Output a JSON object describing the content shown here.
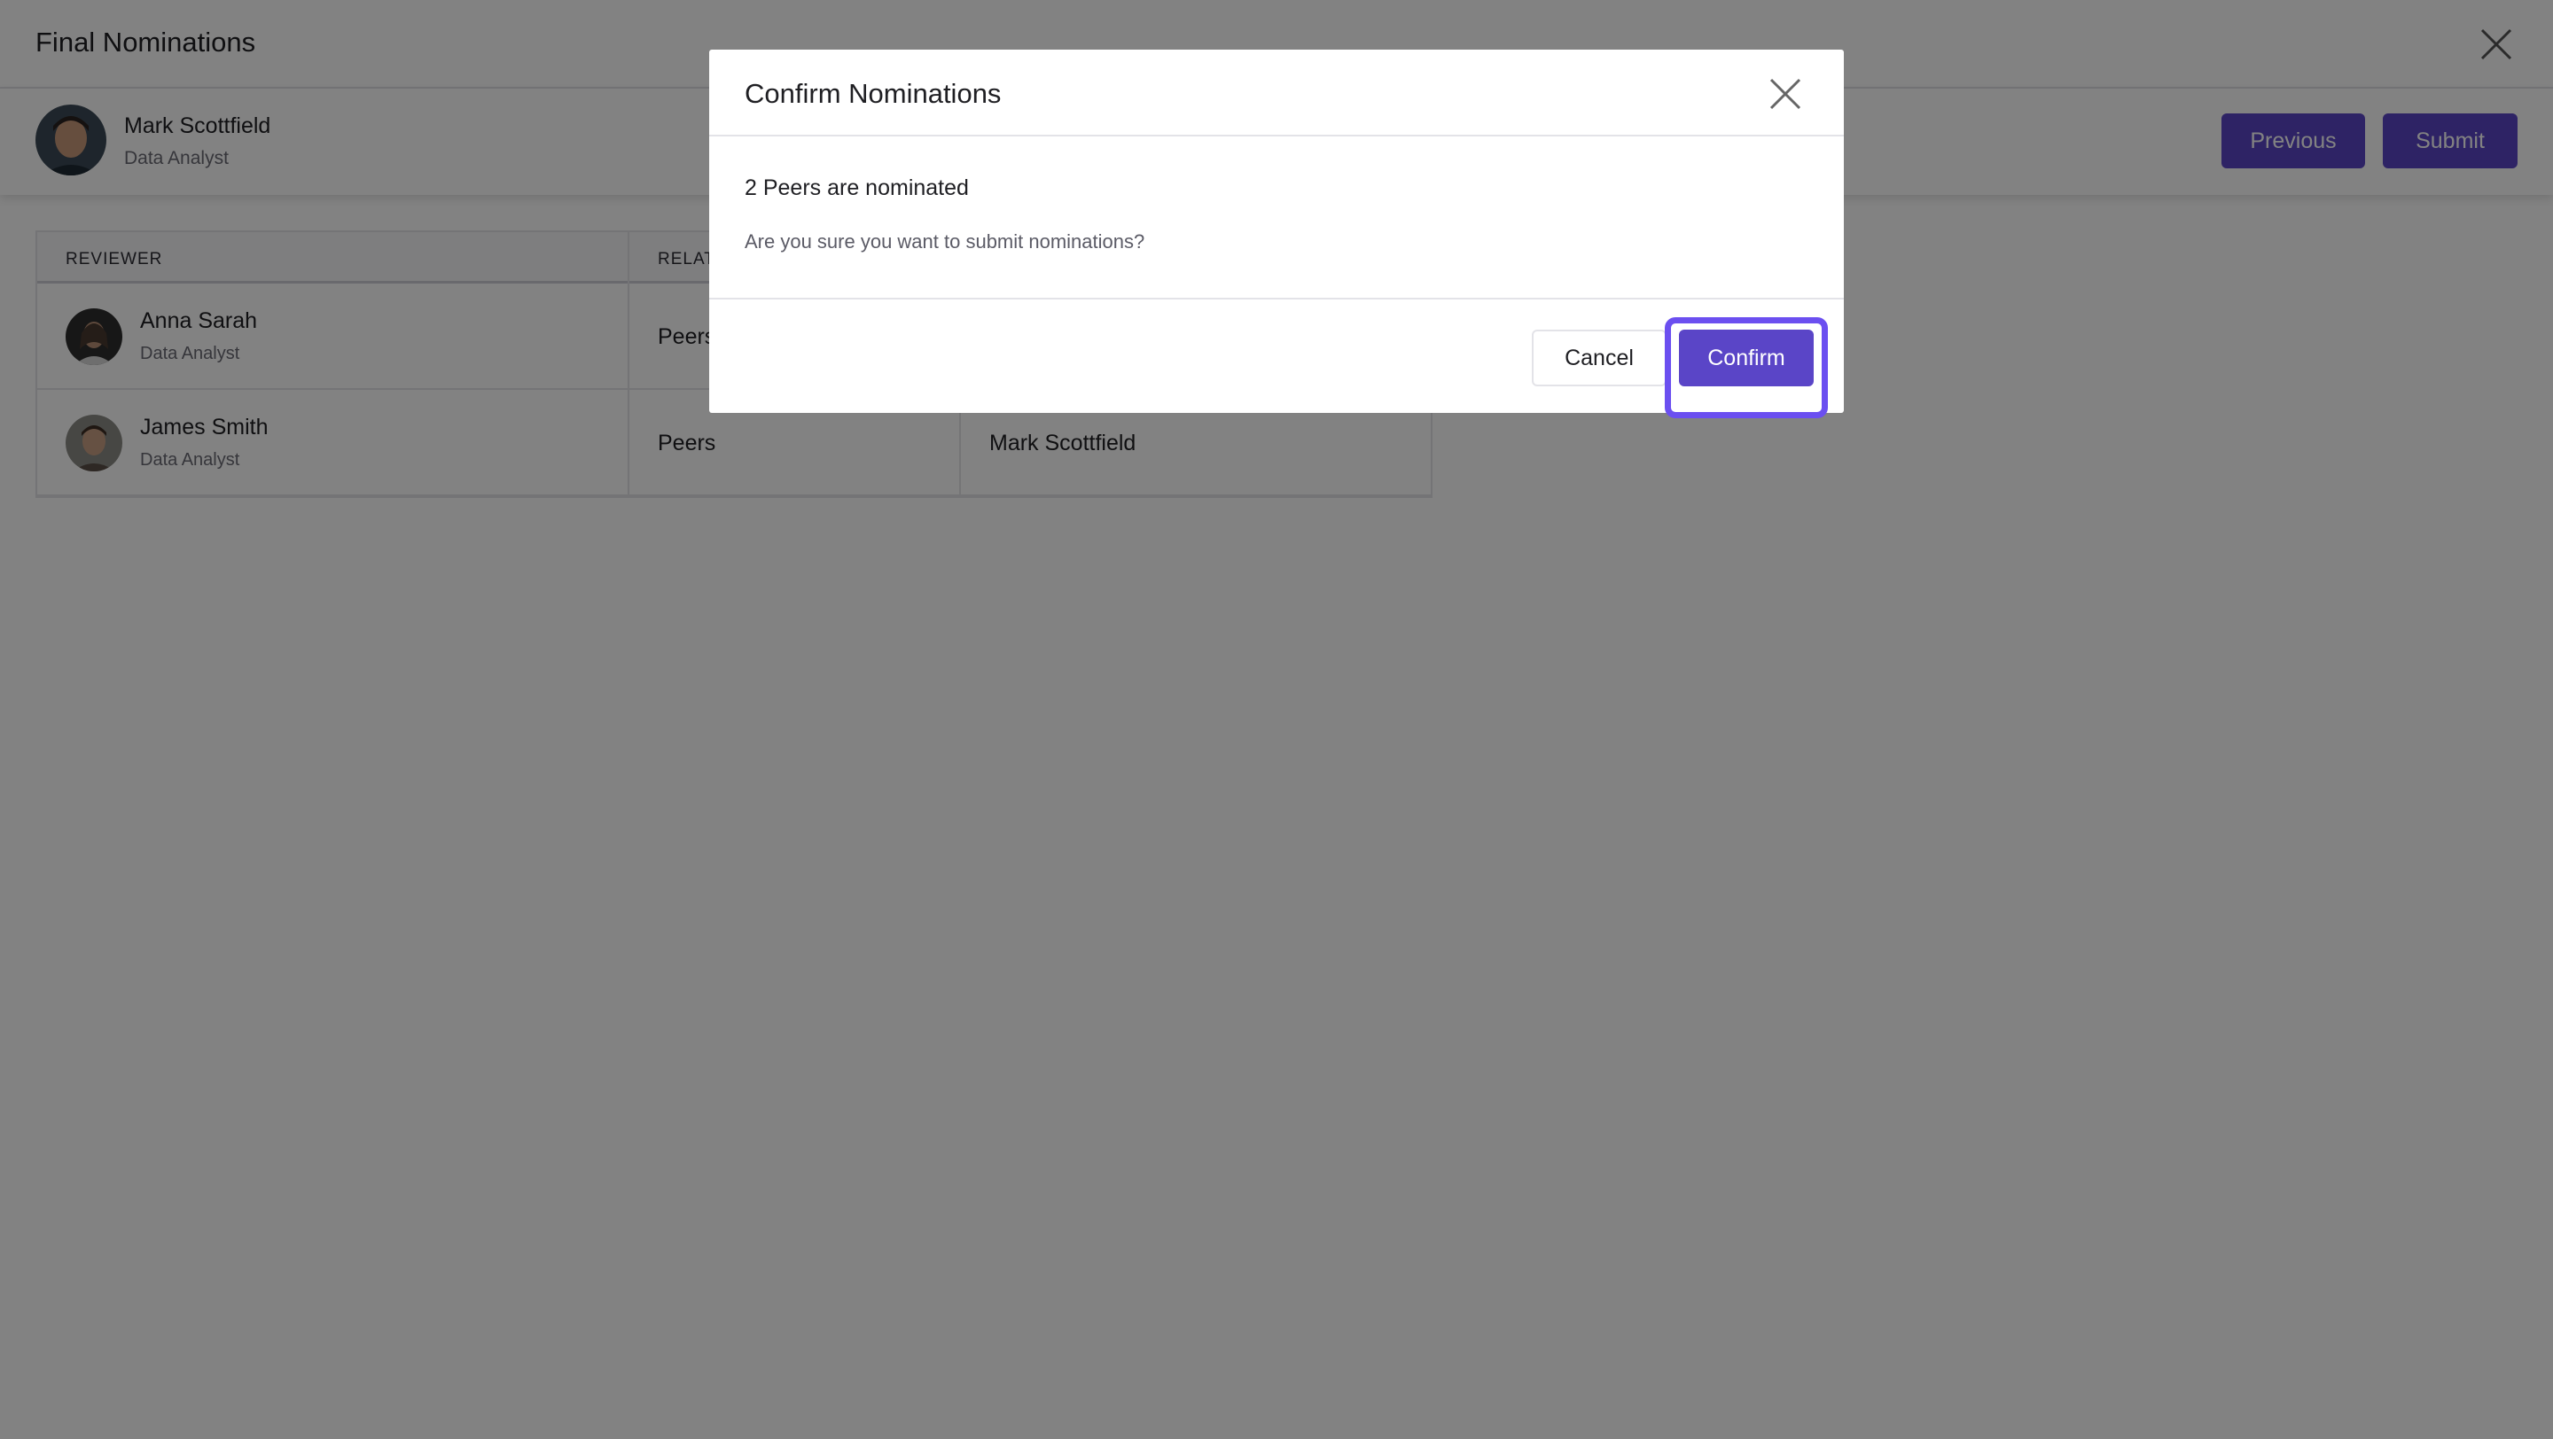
{
  "page": {
    "title": "Final Nominations",
    "close_icon": "close-icon"
  },
  "employee": {
    "name": "Mark Scottfield",
    "role": "Data Analyst"
  },
  "actions": {
    "previous_label": "Previous",
    "submit_label": "Submit"
  },
  "table": {
    "headers": [
      "REVIEWER",
      "RELAT"
    ],
    "rows": [
      {
        "name": "Anna Sarah",
        "role": "Data Analyst",
        "relationship": "Peers",
        "nominated_by": ""
      },
      {
        "name": "James Smith",
        "role": "Data Analyst",
        "relationship": "Peers",
        "nominated_by": "Mark Scottfield"
      }
    ]
  },
  "modal": {
    "title": "Confirm Nominations",
    "heading": "2 Peers are nominated",
    "message": "Are you sure you want to submit nominations?",
    "cancel_label": "Cancel",
    "confirm_label": "Confirm",
    "close_icon": "close-icon"
  },
  "colors": {
    "accent": "#5a45c7",
    "focus_ring": "#6b4ff0",
    "overlay": "rgba(0,0,0,0.49)"
  }
}
